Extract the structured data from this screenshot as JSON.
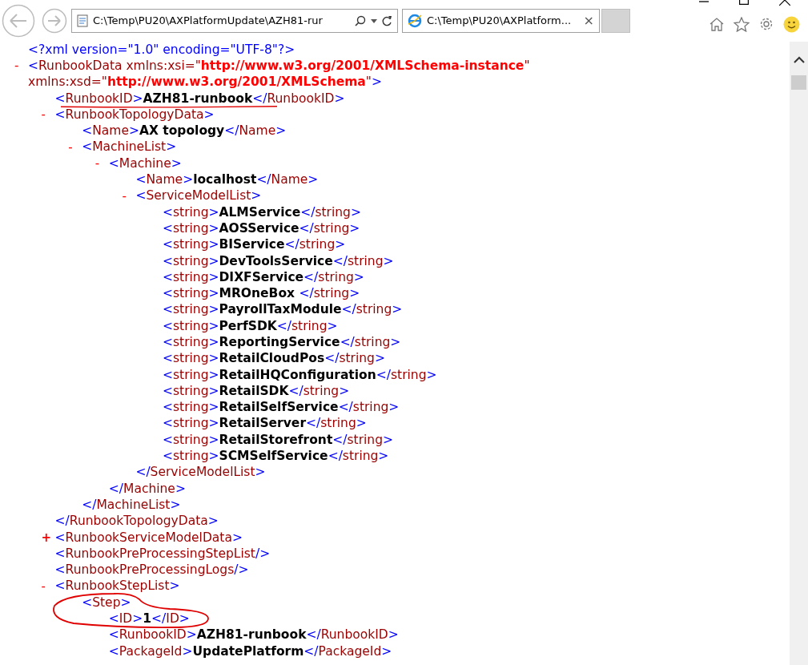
{
  "browser": {
    "address": "C:\\Temp\\PU20\\AXPlatformUpdate\\AZH81-rur",
    "tab_title": "C:\\Temp\\PU20\\AXPlatform...",
    "tab_close": "×"
  },
  "document": [
    {
      "lines": [
        [
          {
            "kind": "pi",
            "text": "<?xml version=\"1.0\" encoding=\"UTF-8\"?>"
          }
        ]
      ]
    },
    {
      "toggle": "-",
      "expanded": true,
      "lines": [
        [
          {
            "kind": "bracket",
            "text": "<"
          },
          {
            "kind": "name",
            "text": "RunbookData"
          },
          {
            "kind": "attr_name",
            "text": " xmlns:xsi=\""
          },
          {
            "kind": "attr_value",
            "text": "http://www.w3.org/2001/XMLSchema-instance"
          },
          {
            "kind": "attr_name",
            "text": "\""
          }
        ],
        [
          {
            "kind": "attr_name",
            "text": "xmlns:xsd=\""
          },
          {
            "kind": "attr_value",
            "text": "http://www.w3.org/2001/XMLSchema"
          },
          {
            "kind": "attr_name",
            "text": "\""
          },
          {
            "kind": "bracket",
            "text": ">"
          }
        ]
      ],
      "children": [
        {
          "lines": [
            [
              {
                "kind": "bracket",
                "text": "<"
              },
              {
                "kind": "name",
                "text": "RunbookID"
              },
              {
                "kind": "bracket",
                "text": ">"
              },
              {
                "kind": "value",
                "text": "AZH81-runbook"
              },
              {
                "kind": "bracket",
                "text": "</"
              },
              {
                "kind": "name",
                "text": "RunbookID"
              },
              {
                "kind": "bracket",
                "text": ">"
              }
            ]
          ]
        },
        {
          "toggle": "-",
          "expanded": true,
          "lines": [
            [
              {
                "kind": "bracket",
                "text": "<"
              },
              {
                "kind": "name",
                "text": "RunbookTopologyData"
              },
              {
                "kind": "bracket",
                "text": ">"
              }
            ]
          ],
          "children": [
            {
              "lines": [
                [
                  {
                    "kind": "bracket",
                    "text": "<"
                  },
                  {
                    "kind": "name",
                    "text": "Name"
                  },
                  {
                    "kind": "bracket",
                    "text": ">"
                  },
                  {
                    "kind": "value",
                    "text": "AX topology"
                  },
                  {
                    "kind": "bracket",
                    "text": "</"
                  },
                  {
                    "kind": "name",
                    "text": "Name"
                  },
                  {
                    "kind": "bracket",
                    "text": ">"
                  }
                ]
              ]
            },
            {
              "toggle": "-",
              "expanded": true,
              "lines": [
                [
                  {
                    "kind": "bracket",
                    "text": "<"
                  },
                  {
                    "kind": "name",
                    "text": "MachineList"
                  },
                  {
                    "kind": "bracket",
                    "text": ">"
                  }
                ]
              ],
              "children": [
                {
                  "toggle": "-",
                  "expanded": true,
                  "lines": [
                    [
                      {
                        "kind": "bracket",
                        "text": "<"
                      },
                      {
                        "kind": "name",
                        "text": "Machine"
                      },
                      {
                        "kind": "bracket",
                        "text": ">"
                      }
                    ]
                  ],
                  "children": [
                    {
                      "lines": [
                        [
                          {
                            "kind": "bracket",
                            "text": "<"
                          },
                          {
                            "kind": "name",
                            "text": "Name"
                          },
                          {
                            "kind": "bracket",
                            "text": ">"
                          },
                          {
                            "kind": "value",
                            "text": "localhost"
                          },
                          {
                            "kind": "bracket",
                            "text": "</"
                          },
                          {
                            "kind": "name",
                            "text": "Name"
                          },
                          {
                            "kind": "bracket",
                            "text": ">"
                          }
                        ]
                      ]
                    },
                    {
                      "toggle": "-",
                      "expanded": true,
                      "lines": [
                        [
                          {
                            "kind": "bracket",
                            "text": "<"
                          },
                          {
                            "kind": "name",
                            "text": "ServiceModelList"
                          },
                          {
                            "kind": "bracket",
                            "text": ">"
                          }
                        ]
                      ],
                      "children": [
                        {
                          "lines": [
                            [
                              {
                                "kind": "bracket",
                                "text": "<"
                              },
                              {
                                "kind": "name",
                                "text": "string"
                              },
                              {
                                "kind": "bracket",
                                "text": ">"
                              },
                              {
                                "kind": "value",
                                "text": "ALMService"
                              },
                              {
                                "kind": "bracket",
                                "text": "</"
                              },
                              {
                                "kind": "name",
                                "text": "string"
                              },
                              {
                                "kind": "bracket",
                                "text": ">"
                              }
                            ]
                          ]
                        },
                        {
                          "lines": [
                            [
                              {
                                "kind": "bracket",
                                "text": "<"
                              },
                              {
                                "kind": "name",
                                "text": "string"
                              },
                              {
                                "kind": "bracket",
                                "text": ">"
                              },
                              {
                                "kind": "value",
                                "text": "AOSService"
                              },
                              {
                                "kind": "bracket",
                                "text": "</"
                              },
                              {
                                "kind": "name",
                                "text": "string"
                              },
                              {
                                "kind": "bracket",
                                "text": ">"
                              }
                            ]
                          ]
                        },
                        {
                          "lines": [
                            [
                              {
                                "kind": "bracket",
                                "text": "<"
                              },
                              {
                                "kind": "name",
                                "text": "string"
                              },
                              {
                                "kind": "bracket",
                                "text": ">"
                              },
                              {
                                "kind": "value",
                                "text": "BIService"
                              },
                              {
                                "kind": "bracket",
                                "text": "</"
                              },
                              {
                                "kind": "name",
                                "text": "string"
                              },
                              {
                                "kind": "bracket",
                                "text": ">"
                              }
                            ]
                          ]
                        },
                        {
                          "lines": [
                            [
                              {
                                "kind": "bracket",
                                "text": "<"
                              },
                              {
                                "kind": "name",
                                "text": "string"
                              },
                              {
                                "kind": "bracket",
                                "text": ">"
                              },
                              {
                                "kind": "value",
                                "text": "DevToolsService"
                              },
                              {
                                "kind": "bracket",
                                "text": "</"
                              },
                              {
                                "kind": "name",
                                "text": "string"
                              },
                              {
                                "kind": "bracket",
                                "text": ">"
                              }
                            ]
                          ]
                        },
                        {
                          "lines": [
                            [
                              {
                                "kind": "bracket",
                                "text": "<"
                              },
                              {
                                "kind": "name",
                                "text": "string"
                              },
                              {
                                "kind": "bracket",
                                "text": ">"
                              },
                              {
                                "kind": "value",
                                "text": "DIXFService"
                              },
                              {
                                "kind": "bracket",
                                "text": "</"
                              },
                              {
                                "kind": "name",
                                "text": "string"
                              },
                              {
                                "kind": "bracket",
                                "text": ">"
                              }
                            ]
                          ]
                        },
                        {
                          "lines": [
                            [
                              {
                                "kind": "bracket",
                                "text": "<"
                              },
                              {
                                "kind": "name",
                                "text": "string"
                              },
                              {
                                "kind": "bracket",
                                "text": ">"
                              },
                              {
                                "kind": "value",
                                "text": "MROneBox "
                              },
                              {
                                "kind": "bracket",
                                "text": "</"
                              },
                              {
                                "kind": "name",
                                "text": "string"
                              },
                              {
                                "kind": "bracket",
                                "text": ">"
                              }
                            ]
                          ]
                        },
                        {
                          "lines": [
                            [
                              {
                                "kind": "bracket",
                                "text": "<"
                              },
                              {
                                "kind": "name",
                                "text": "string"
                              },
                              {
                                "kind": "bracket",
                                "text": ">"
                              },
                              {
                                "kind": "value",
                                "text": "PayrollTaxModule"
                              },
                              {
                                "kind": "bracket",
                                "text": "</"
                              },
                              {
                                "kind": "name",
                                "text": "string"
                              },
                              {
                                "kind": "bracket",
                                "text": ">"
                              }
                            ]
                          ]
                        },
                        {
                          "lines": [
                            [
                              {
                                "kind": "bracket",
                                "text": "<"
                              },
                              {
                                "kind": "name",
                                "text": "string"
                              },
                              {
                                "kind": "bracket",
                                "text": ">"
                              },
                              {
                                "kind": "value",
                                "text": "PerfSDK"
                              },
                              {
                                "kind": "bracket",
                                "text": "</"
                              },
                              {
                                "kind": "name",
                                "text": "string"
                              },
                              {
                                "kind": "bracket",
                                "text": ">"
                              }
                            ]
                          ]
                        },
                        {
                          "lines": [
                            [
                              {
                                "kind": "bracket",
                                "text": "<"
                              },
                              {
                                "kind": "name",
                                "text": "string"
                              },
                              {
                                "kind": "bracket",
                                "text": ">"
                              },
                              {
                                "kind": "value",
                                "text": "ReportingService"
                              },
                              {
                                "kind": "bracket",
                                "text": "</"
                              },
                              {
                                "kind": "name",
                                "text": "string"
                              },
                              {
                                "kind": "bracket",
                                "text": ">"
                              }
                            ]
                          ]
                        },
                        {
                          "lines": [
                            [
                              {
                                "kind": "bracket",
                                "text": "<"
                              },
                              {
                                "kind": "name",
                                "text": "string"
                              },
                              {
                                "kind": "bracket",
                                "text": ">"
                              },
                              {
                                "kind": "value",
                                "text": "RetailCloudPos"
                              },
                              {
                                "kind": "bracket",
                                "text": "</"
                              },
                              {
                                "kind": "name",
                                "text": "string"
                              },
                              {
                                "kind": "bracket",
                                "text": ">"
                              }
                            ]
                          ]
                        },
                        {
                          "lines": [
                            [
                              {
                                "kind": "bracket",
                                "text": "<"
                              },
                              {
                                "kind": "name",
                                "text": "string"
                              },
                              {
                                "kind": "bracket",
                                "text": ">"
                              },
                              {
                                "kind": "value",
                                "text": "RetailHQConfiguration"
                              },
                              {
                                "kind": "bracket",
                                "text": "</"
                              },
                              {
                                "kind": "name",
                                "text": "string"
                              },
                              {
                                "kind": "bracket",
                                "text": ">"
                              }
                            ]
                          ]
                        },
                        {
                          "lines": [
                            [
                              {
                                "kind": "bracket",
                                "text": "<"
                              },
                              {
                                "kind": "name",
                                "text": "string"
                              },
                              {
                                "kind": "bracket",
                                "text": ">"
                              },
                              {
                                "kind": "value",
                                "text": "RetailSDK"
                              },
                              {
                                "kind": "bracket",
                                "text": "</"
                              },
                              {
                                "kind": "name",
                                "text": "string"
                              },
                              {
                                "kind": "bracket",
                                "text": ">"
                              }
                            ]
                          ]
                        },
                        {
                          "lines": [
                            [
                              {
                                "kind": "bracket",
                                "text": "<"
                              },
                              {
                                "kind": "name",
                                "text": "string"
                              },
                              {
                                "kind": "bracket",
                                "text": ">"
                              },
                              {
                                "kind": "value",
                                "text": "RetailSelfService"
                              },
                              {
                                "kind": "bracket",
                                "text": "</"
                              },
                              {
                                "kind": "name",
                                "text": "string"
                              },
                              {
                                "kind": "bracket",
                                "text": ">"
                              }
                            ]
                          ]
                        },
                        {
                          "lines": [
                            [
                              {
                                "kind": "bracket",
                                "text": "<"
                              },
                              {
                                "kind": "name",
                                "text": "string"
                              },
                              {
                                "kind": "bracket",
                                "text": ">"
                              },
                              {
                                "kind": "value",
                                "text": "RetailServer"
                              },
                              {
                                "kind": "bracket",
                                "text": "</"
                              },
                              {
                                "kind": "name",
                                "text": "string"
                              },
                              {
                                "kind": "bracket",
                                "text": ">"
                              }
                            ]
                          ]
                        },
                        {
                          "lines": [
                            [
                              {
                                "kind": "bracket",
                                "text": "<"
                              },
                              {
                                "kind": "name",
                                "text": "string"
                              },
                              {
                                "kind": "bracket",
                                "text": ">"
                              },
                              {
                                "kind": "value",
                                "text": "RetailStorefront"
                              },
                              {
                                "kind": "bracket",
                                "text": "</"
                              },
                              {
                                "kind": "name",
                                "text": "string"
                              },
                              {
                                "kind": "bracket",
                                "text": ">"
                              }
                            ]
                          ]
                        },
                        {
                          "lines": [
                            [
                              {
                                "kind": "bracket",
                                "text": "<"
                              },
                              {
                                "kind": "name",
                                "text": "string"
                              },
                              {
                                "kind": "bracket",
                                "text": ">"
                              },
                              {
                                "kind": "value",
                                "text": "SCMSelfService"
                              },
                              {
                                "kind": "bracket",
                                "text": "</"
                              },
                              {
                                "kind": "name",
                                "text": "string"
                              },
                              {
                                "kind": "bracket",
                                "text": ">"
                              }
                            ]
                          ]
                        }
                      ],
                      "end": [
                        {
                          "kind": "bracket",
                          "text": "</"
                        },
                        {
                          "kind": "name",
                          "text": "ServiceModelList"
                        },
                        {
                          "kind": "bracket",
                          "text": ">"
                        }
                      ]
                    }
                  ],
                  "end": [
                    {
                      "kind": "bracket",
                      "text": "</"
                    },
                    {
                      "kind": "name",
                      "text": "Machine"
                    },
                    {
                      "kind": "bracket",
                      "text": ">"
                    }
                  ]
                }
              ],
              "end": [
                {
                  "kind": "bracket",
                  "text": "</"
                },
                {
                  "kind": "name",
                  "text": "MachineList"
                },
                {
                  "kind": "bracket",
                  "text": ">"
                }
              ]
            }
          ],
          "end": [
            {
              "kind": "bracket",
              "text": "</"
            },
            {
              "kind": "name",
              "text": "RunbookTopologyData"
            },
            {
              "kind": "bracket",
              "text": ">"
            }
          ]
        },
        {
          "toggle": "+",
          "expanded": false,
          "lines": [
            [
              {
                "kind": "bracket",
                "text": "<"
              },
              {
                "kind": "name",
                "text": "RunbookServiceModelData"
              },
              {
                "kind": "bracket",
                "text": ">"
              }
            ]
          ]
        },
        {
          "lines": [
            [
              {
                "kind": "bracket",
                "text": "<"
              },
              {
                "kind": "name",
                "text": "RunbookPreProcessingStepList"
              },
              {
                "kind": "bracket",
                "text": "/>"
              }
            ]
          ]
        },
        {
          "lines": [
            [
              {
                "kind": "bracket",
                "text": "<"
              },
              {
                "kind": "name",
                "text": "RunbookPreProcessingLogs"
              },
              {
                "kind": "bracket",
                "text": "/>"
              }
            ]
          ]
        },
        {
          "toggle": "-",
          "expanded": true,
          "lines": [
            [
              {
                "kind": "bracket",
                "text": "<"
              },
              {
                "kind": "name",
                "text": "RunbookStepList"
              },
              {
                "kind": "bracket",
                "text": ">"
              }
            ]
          ],
          "children": [
            {
              "lines": [
                [
                  {
                    "kind": "bracket",
                    "text": "<"
                  },
                  {
                    "kind": "name",
                    "text": "Step"
                  },
                  {
                    "kind": "bracket",
                    "text": ">"
                  }
                ]
              ],
              "children": [
                {
                  "lines": [
                    [
                      {
                        "kind": "bracket",
                        "text": "<"
                      },
                      {
                        "kind": "name",
                        "text": "ID"
                      },
                      {
                        "kind": "bracket",
                        "text": ">"
                      },
                      {
                        "kind": "value",
                        "text": "1"
                      },
                      {
                        "kind": "bracket",
                        "text": "</"
                      },
                      {
                        "kind": "name",
                        "text": "ID"
                      },
                      {
                        "kind": "bracket",
                        "text": ">"
                      }
                    ]
                  ]
                },
                {
                  "lines": [
                    [
                      {
                        "kind": "bracket",
                        "text": "<"
                      },
                      {
                        "kind": "name",
                        "text": "RunbookID"
                      },
                      {
                        "kind": "bracket",
                        "text": ">"
                      },
                      {
                        "kind": "value",
                        "text": "AZH81-runbook"
                      },
                      {
                        "kind": "bracket",
                        "text": "</"
                      },
                      {
                        "kind": "name",
                        "text": "RunbookID"
                      },
                      {
                        "kind": "bracket",
                        "text": ">"
                      }
                    ]
                  ]
                },
                {
                  "lines": [
                    [
                      {
                        "kind": "bracket",
                        "text": "<"
                      },
                      {
                        "kind": "name",
                        "text": "PackageId"
                      },
                      {
                        "kind": "bracket",
                        "text": ">"
                      },
                      {
                        "kind": "value",
                        "text": "UpdatePlatform"
                      },
                      {
                        "kind": "bracket",
                        "text": "</"
                      },
                      {
                        "kind": "name",
                        "text": "PackageId"
                      },
                      {
                        "kind": "bracket",
                        "text": ">"
                      }
                    ]
                  ]
                }
              ]
            }
          ]
        }
      ]
    }
  ]
}
